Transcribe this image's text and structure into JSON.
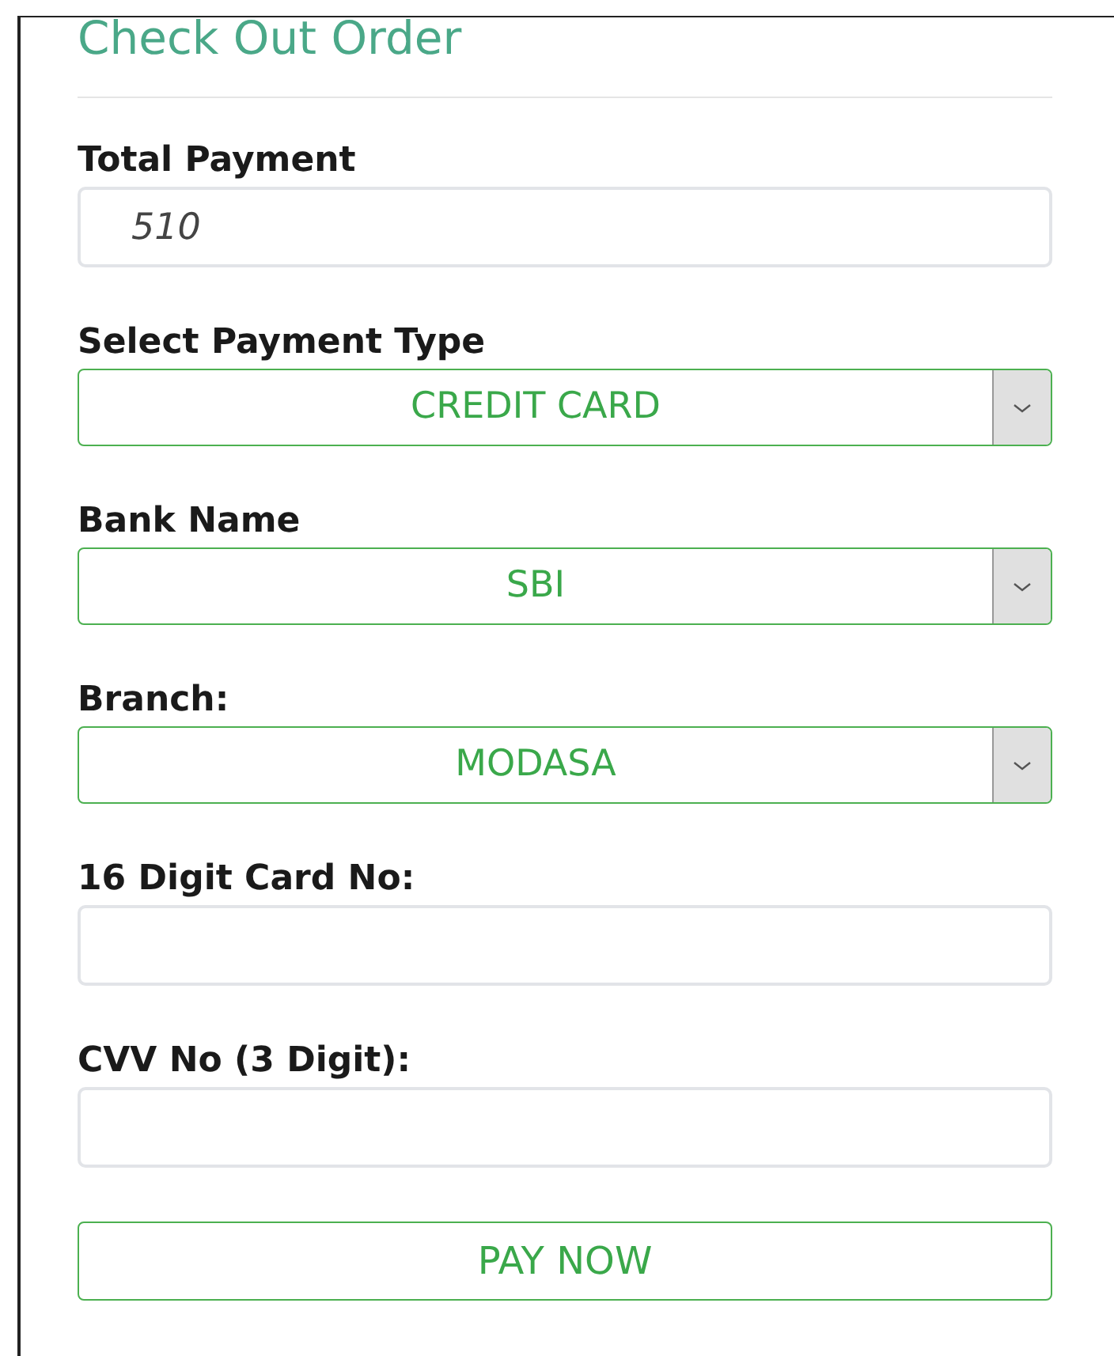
{
  "title": "Check Out Order",
  "fields": [
    {
      "kind": "text",
      "label": "Total Payment",
      "value": "510"
    },
    {
      "kind": "select",
      "label": "Select Payment Type",
      "value": "CREDIT CARD"
    },
    {
      "kind": "select",
      "label": "Bank Name",
      "value": "SBI"
    },
    {
      "kind": "select",
      "label": "Branch:",
      "value": "MODASA"
    },
    {
      "kind": "text",
      "label": "16 Digit Card No:"
    },
    {
      "kind": "text",
      "label": "CVV No (3 Digit):"
    }
  ],
  "button": "PAY NOW"
}
